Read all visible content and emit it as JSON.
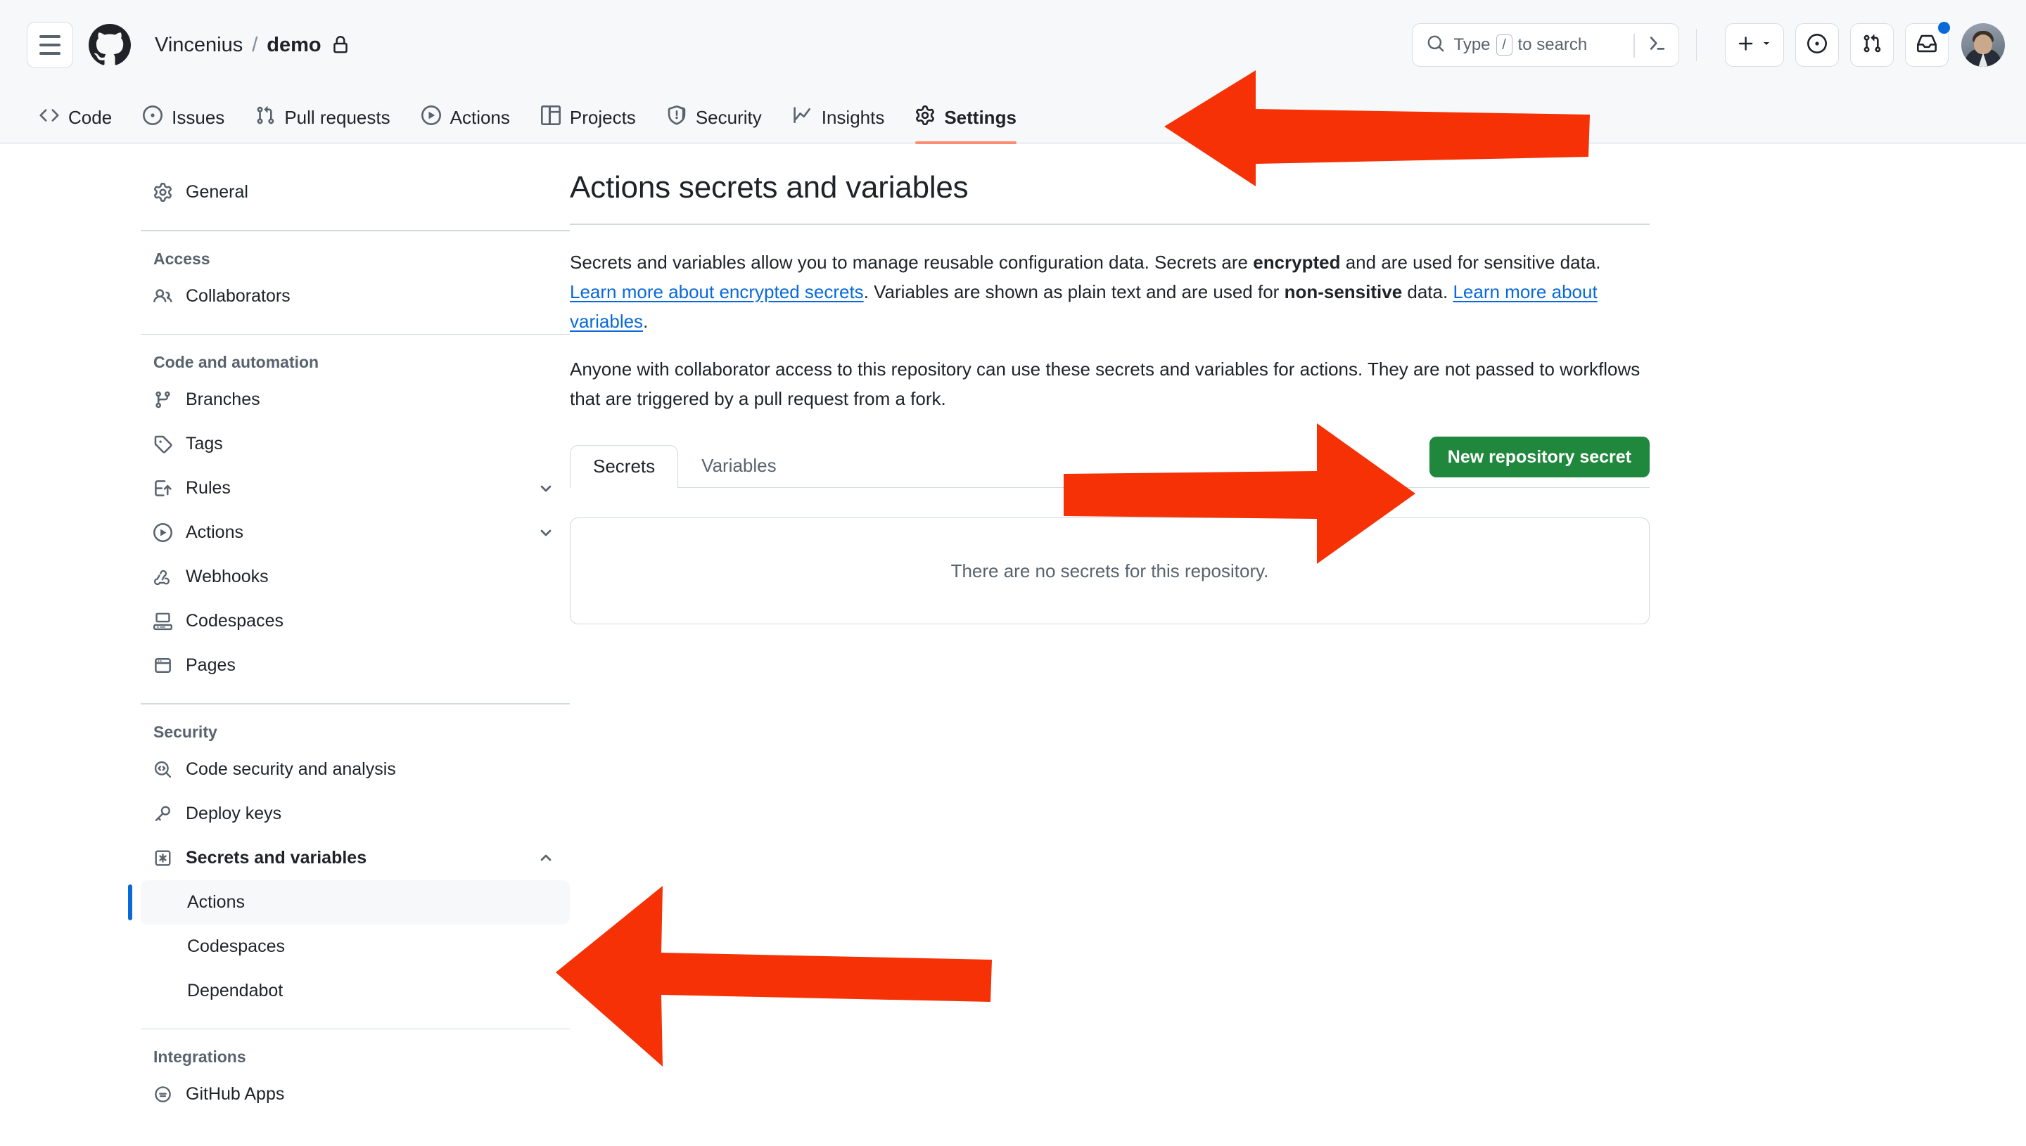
{
  "header": {
    "menu_label": "Open global navigation menu",
    "logo_name": "github-logo",
    "owner": "Vincenius",
    "separator": "/",
    "repo": "demo",
    "visibility_icon": "lock-icon",
    "search": {
      "placeholder_prefix": "Type",
      "placeholder_key": "/",
      "placeholder_suffix": "to search",
      "full_placeholder": "Type / to search",
      "terminal_icon": "command-palette-icon"
    },
    "actions": [
      {
        "name": "create-new-button",
        "icon": "plus-icon",
        "caret": true
      },
      {
        "name": "issues-button",
        "icon": "issue-opened-icon"
      },
      {
        "name": "pull-requests-button",
        "icon": "git-pull-request-icon"
      },
      {
        "name": "notifications-button",
        "icon": "inbox-icon",
        "has_unread_dot": true
      }
    ],
    "avatar_name": "user-avatar"
  },
  "repo_nav": {
    "tabs": [
      {
        "label": "Code",
        "icon": "code-icon",
        "active": false
      },
      {
        "label": "Issues",
        "icon": "issue-opened-icon",
        "active": false
      },
      {
        "label": "Pull requests",
        "icon": "git-pull-request-icon",
        "active": false
      },
      {
        "label": "Actions",
        "icon": "play-icon",
        "active": false
      },
      {
        "label": "Projects",
        "icon": "table-icon",
        "active": false
      },
      {
        "label": "Security",
        "icon": "shield-icon",
        "active": false
      },
      {
        "label": "Insights",
        "icon": "graph-icon",
        "active": false
      },
      {
        "label": "Settings",
        "icon": "gear-icon",
        "active": true
      }
    ]
  },
  "sidebar": {
    "general": {
      "label": "General",
      "icon": "gear-icon"
    },
    "sections": [
      {
        "title": "Access",
        "items": [
          {
            "label": "Collaborators",
            "icon": "people-icon"
          }
        ]
      },
      {
        "title": "Code and automation",
        "items": [
          {
            "label": "Branches",
            "icon": "git-branch-icon"
          },
          {
            "label": "Tags",
            "icon": "tag-icon"
          },
          {
            "label": "Rules",
            "icon": "rules-icon",
            "chevron": "chevron-down-icon"
          },
          {
            "label": "Actions",
            "icon": "play-icon",
            "chevron": "chevron-down-icon"
          },
          {
            "label": "Webhooks",
            "icon": "webhook-icon"
          },
          {
            "label": "Codespaces",
            "icon": "codespaces-icon"
          },
          {
            "label": "Pages",
            "icon": "browser-icon"
          }
        ]
      },
      {
        "title": "Security",
        "items": [
          {
            "label": "Code security and analysis",
            "icon": "codescan-icon"
          },
          {
            "label": "Deploy keys",
            "icon": "key-icon"
          },
          {
            "label": "Secrets and variables",
            "icon": "asterisk-icon",
            "chevron": "chevron-up-icon",
            "expanded": true,
            "bold": true,
            "children": [
              {
                "label": "Actions",
                "selected": true
              },
              {
                "label": "Codespaces",
                "selected": false
              },
              {
                "label": "Dependabot",
                "selected": false
              }
            ]
          }
        ]
      },
      {
        "title": "Integrations",
        "items": [
          {
            "label": "GitHub Apps",
            "icon": "github-apps-icon"
          }
        ]
      }
    ]
  },
  "main": {
    "title": "Actions secrets and variables",
    "paragraph1": {
      "part1": "Secrets and variables allow you to manage reusable configuration data. Secrets are ",
      "bold1": "encrypted",
      "part2": " and are used for sensitive data. ",
      "link1": "Learn more about encrypted secrets",
      "part3": ". Variables are shown as plain text and are used for ",
      "bold2": "non-sensitive",
      "part4": " data. ",
      "link2": "Learn more about variables",
      "part5": "."
    },
    "paragraph2": "Anyone with collaborator access to this repository can use these secrets and variables for actions. They are not passed to workflows that are triggered by a pull request from a fork.",
    "tabs": [
      {
        "label": "Secrets",
        "active": true
      },
      {
        "label": "Variables",
        "active": false
      }
    ],
    "new_secret_button": "New repository secret",
    "empty_state": "There are no secrets for this repository."
  },
  "annotations": {
    "arrow_color": "#f53105",
    "arrows": [
      {
        "name": "arrow-to-settings-tab",
        "target": "Settings"
      },
      {
        "name": "arrow-to-new-repository-secret-button",
        "target": "New repository secret"
      },
      {
        "name": "arrow-to-sidebar-actions-item",
        "target": "Actions"
      }
    ]
  },
  "colors": {
    "accent_green": "#1f883d",
    "link_blue": "#0969da",
    "active_tab_underline": "#fd8c73",
    "header_bg": "#f6f8fa",
    "border": "#d1d9e0"
  }
}
